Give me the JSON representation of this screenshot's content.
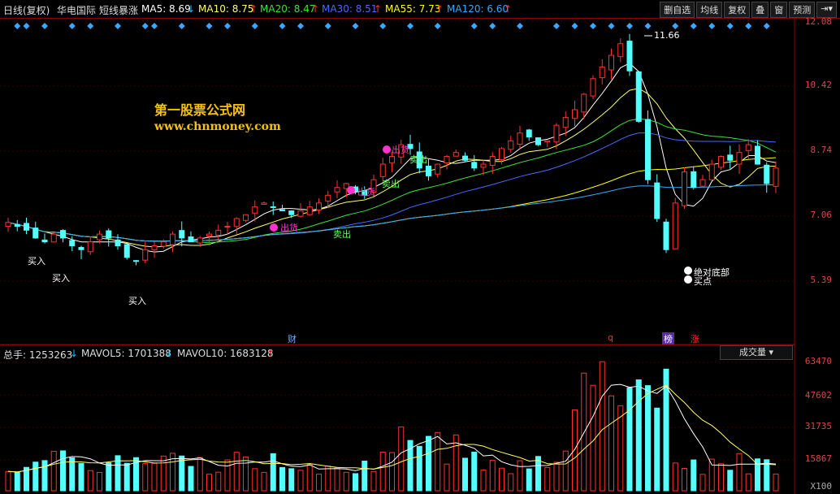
{
  "header": {
    "period": "日线(复权)",
    "stock_name": "华电国际",
    "indicator": "短线暴涨",
    "ma5": "MA5: 8.69",
    "ma10": "MA10: 8.75",
    "ma20": "MA20: 8.47",
    "ma30": "MA30: 8.51",
    "ma55": "MA55: 7.73",
    "ma120": "MA120: 6.60",
    "buttons": [
      "删自选",
      "均线",
      "复权",
      "叠",
      "窗",
      "预测"
    ]
  },
  "price_axis": [
    "12.08",
    "10.42",
    "8.74",
    "7.06",
    "5.39"
  ],
  "volume_axis": [
    "63470",
    "47602",
    "31735",
    "15867"
  ],
  "volume_axis_unit": "X100",
  "watermark": {
    "line1": "第一股票公式网",
    "line2": "www.chnmoney.com"
  },
  "annotations": {
    "peak": "11.66",
    "buy1": "买入",
    "buy2": "买入",
    "buy3": "买入",
    "sell1": "出货",
    "sell2": "卖出",
    "sell3": "出货",
    "sell4": "卖出",
    "sell5": "出货",
    "sell6": "卖出",
    "bottom1": "绝对底部",
    "bottom2": "买点",
    "event_cai": "财",
    "event_q": "q",
    "event_bang": "榜",
    "event_zhang": "涨"
  },
  "volume_header": {
    "total": "总手: 1253263",
    "mavol5": "MAVOL5: 1701388",
    "mavol10": "MAVOL10: 1683128",
    "selector": "成交量"
  },
  "colors": {
    "up": "#ff3030",
    "down": "#54ffff",
    "ma5": "#ffffff",
    "ma10": "#ffff66",
    "ma20": "#3ee03e",
    "ma30": "#4c66ff",
    "ma55": "#ffff00",
    "ma120": "#33aaff"
  },
  "chart_data": {
    "type": "candlestick",
    "price_ylim": [
      5.39,
      12.08
    ],
    "volume_ylim": [
      0,
      63470
    ],
    "close_series": [
      6.9,
      6.8,
      6.7,
      6.5,
      6.4,
      6.6,
      6.5,
      6.3,
      6.2,
      6.4,
      6.6,
      6.5,
      6.3,
      6.0,
      5.9,
      6.2,
      6.3,
      6.4,
      6.6,
      6.5,
      6.4,
      6.5,
      6.6,
      6.7,
      6.8,
      7.0,
      7.1,
      7.3,
      7.4,
      7.3,
      7.2,
      7.1,
      7.2,
      7.3,
      7.4,
      7.6,
      7.8,
      7.9,
      7.7,
      7.6,
      8.0,
      8.4,
      8.6,
      8.9,
      8.8,
      8.3,
      8.1,
      8.4,
      8.6,
      8.7,
      8.5,
      8.3,
      8.4,
      8.6,
      8.8,
      9.0,
      9.2,
      9.1,
      8.9,
      9.0,
      9.4,
      9.6,
      9.8,
      10.2,
      10.6,
      10.9,
      11.2,
      11.5,
      10.8,
      9.5,
      8.0,
      7.0,
      6.2,
      7.4,
      8.2,
      7.8,
      8.0,
      8.4,
      8.6,
      8.5,
      8.7,
      8.9,
      8.4,
      7.9,
      8.3
    ]
  }
}
